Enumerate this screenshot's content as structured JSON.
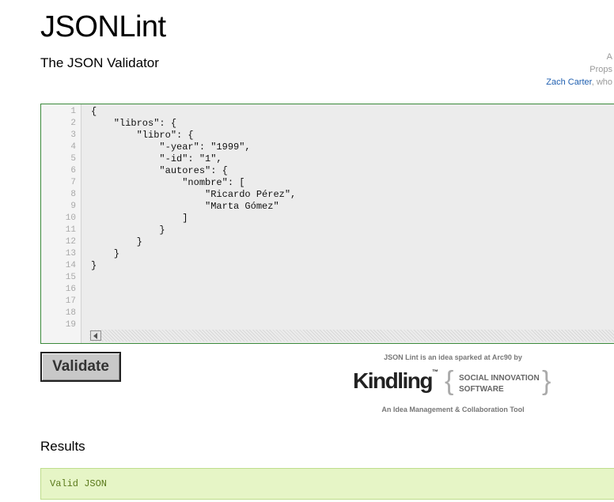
{
  "header": {
    "title": "JSONLint",
    "subtitle": "The JSON Validator",
    "credits_line1": "A",
    "credits_line2": "Props",
    "credits_author": "Zach Carter",
    "credits_rest": ", who"
  },
  "editor": {
    "line_numbers": [
      "1",
      "2",
      "3",
      "4",
      "5",
      "6",
      "7",
      "8",
      "9",
      "10",
      "11",
      "12",
      "13",
      "14",
      "15",
      "16",
      "17",
      "18",
      "19"
    ],
    "lines": [
      "{",
      "    \"libros\": {",
      "        \"libro\": {",
      "            \"-year\": \"1999\",",
      "            \"-id\": \"1\",",
      "            \"autores\": {",
      "                \"nombre\": [",
      "                    \"Ricardo Pérez\",",
      "                    \"Marta Gómez\"",
      "                ]",
      "            }",
      "        }",
      "    }",
      "}"
    ]
  },
  "validate_button": {
    "label": "Validate"
  },
  "sponsor": {
    "top_text": "JSON Lint is an idea sparked at Arc90 by",
    "brand": "Kindling",
    "brand_tm": "™",
    "tagline_1": "SOCIAL INNOVATION",
    "tagline_2": "SOFTWARE",
    "bottom_text": "An Idea Management & Collaboration Tool"
  },
  "results": {
    "heading": "Results",
    "message": "Valid JSON",
    "box_color": "#e6f5c6",
    "text_color": "#5b7a1c"
  }
}
